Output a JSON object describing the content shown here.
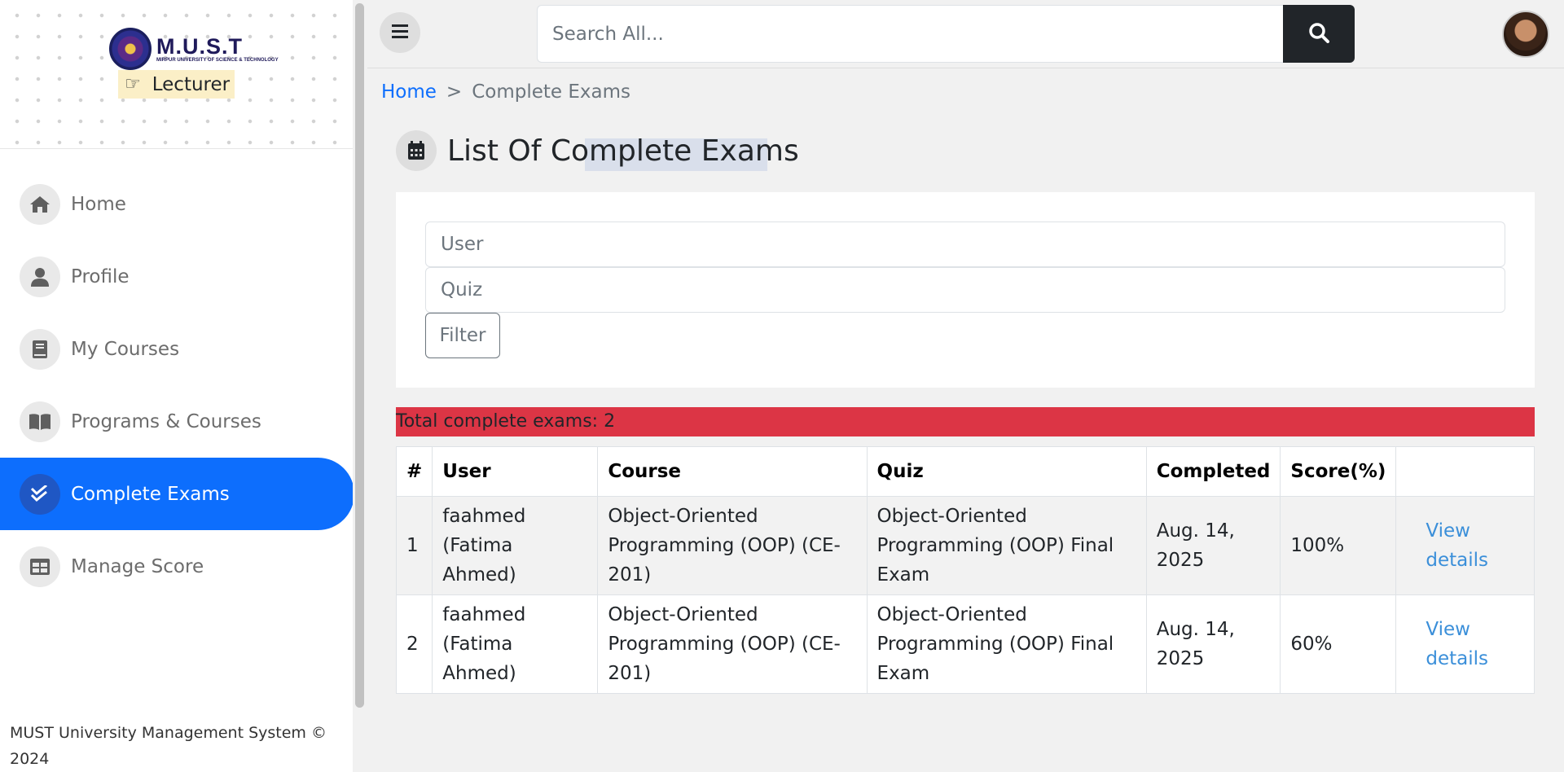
{
  "brand": {
    "logo_title": "M.U.S.T",
    "logo_subtitle": "MIRPUR UNIVERSITY OF SCIENCE & TECHNOLOGY",
    "role": "Lecturer"
  },
  "sidebar": {
    "items": [
      {
        "label": "Home",
        "icon": "home-icon"
      },
      {
        "label": "Profile",
        "icon": "user-icon"
      },
      {
        "label": "My Courses",
        "icon": "book-icon"
      },
      {
        "label": "Programs & Courses",
        "icon": "open-book-icon"
      },
      {
        "label": "Complete Exams",
        "icon": "double-check-icon",
        "active": true
      },
      {
        "label": "Manage Score",
        "icon": "table-icon"
      }
    ],
    "footer": "MUST University Management System © 2024"
  },
  "topbar": {
    "search_placeholder": "Search All..."
  },
  "breadcrumb": {
    "home": "Home",
    "separator": ">",
    "current": "Complete Exams"
  },
  "page": {
    "title": "List Of Complete Exams"
  },
  "filter": {
    "user_placeholder": "User",
    "quiz_placeholder": "Quiz",
    "button": "Filter"
  },
  "summary": {
    "total_text": "Total complete exams: 2"
  },
  "table": {
    "headers": [
      "#",
      "User",
      "Course",
      "Quiz",
      "Completed",
      "Score(%)",
      ""
    ],
    "rows": [
      {
        "num": "1",
        "user": "faahmed (Fatima Ahmed)",
        "course": "Object-Oriented Programming (OOP) (CE-201)",
        "quiz": "Object-Oriented Programming (OOP) Final Exam",
        "completed": "Aug. 14, 2025",
        "score": "100%",
        "action": "View details"
      },
      {
        "num": "2",
        "user": "faahmed (Fatima Ahmed)",
        "course": "Object-Oriented Programming (OOP) (CE-201)",
        "quiz": "Object-Oriented Programming (OOP) Final Exam",
        "completed": "Aug. 14, 2025",
        "score": "60%",
        "action": "View details"
      }
    ]
  },
  "colors": {
    "accent": "#0d6efd",
    "danger": "#dc3545",
    "dark": "#212529",
    "role_bg": "#fbefc7",
    "link": "#3b8fd9"
  }
}
